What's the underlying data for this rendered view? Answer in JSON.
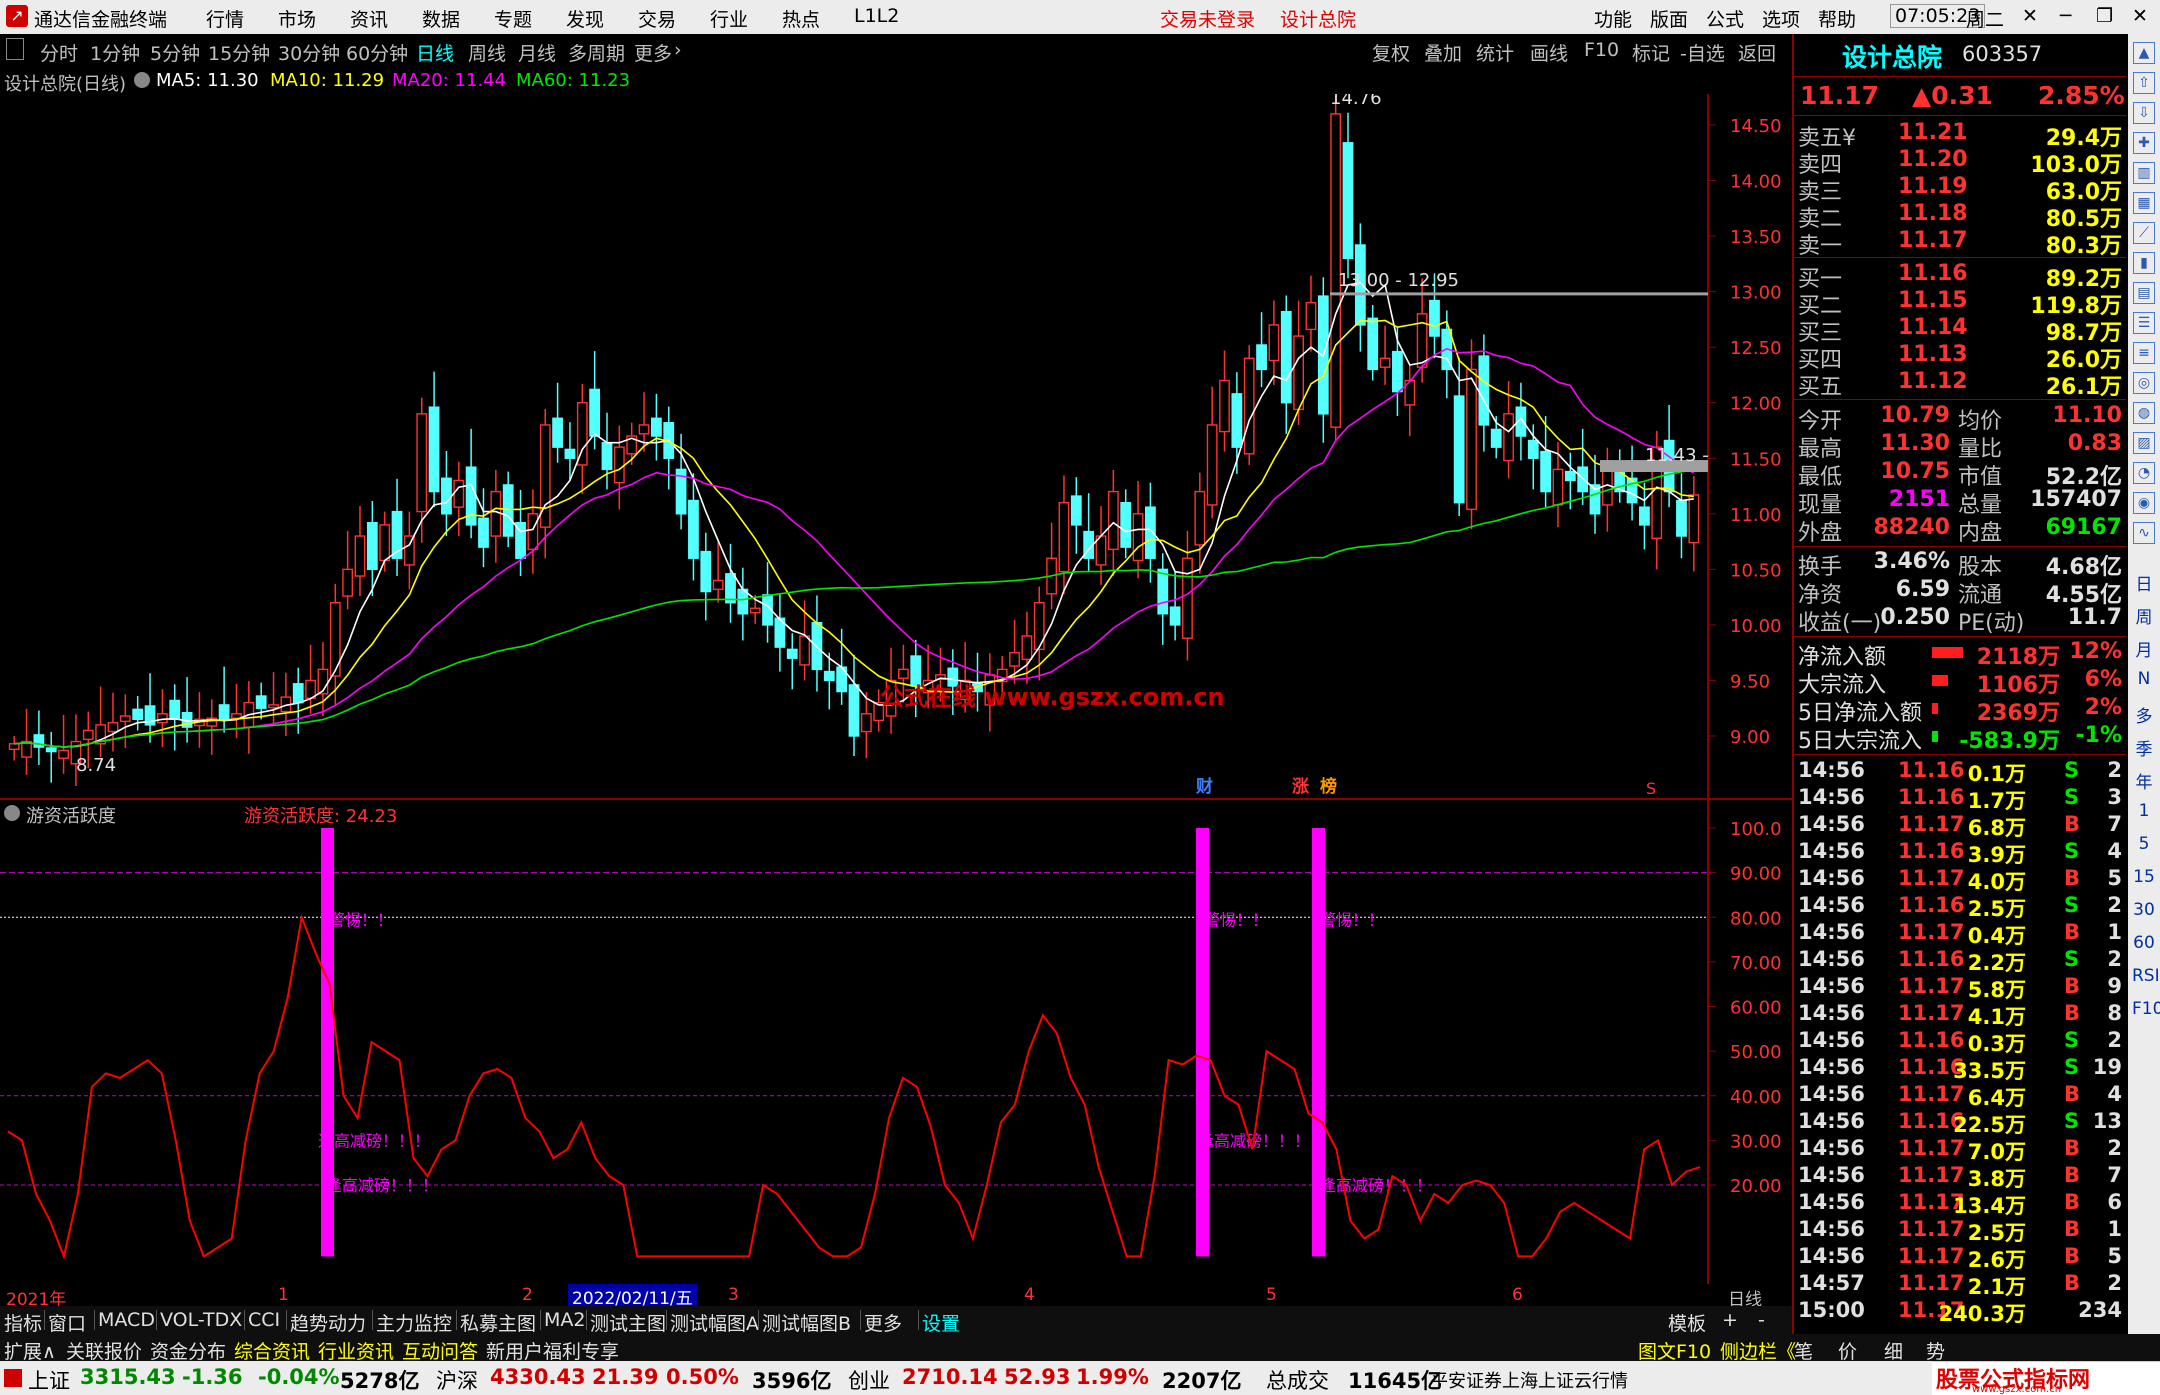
{
  "app": {
    "title": "通达信金融终端",
    "menus": [
      "行情",
      "市场",
      "资讯",
      "数据",
      "专题",
      "发现",
      "交易",
      "行业",
      "热点",
      "L1L2"
    ],
    "trade_status": "交易未登录",
    "stock_title": "设计总院",
    "right_menus": [
      "功能",
      "版面",
      "公式",
      "选项",
      "帮助"
    ],
    "time": "07:05:23",
    "weekday": "周二"
  },
  "periods": [
    "分时",
    "1分钟",
    "5分钟",
    "15分钟",
    "30分钟",
    "60分钟",
    "日线",
    "周线",
    "月线",
    "多周期",
    "更多"
  ],
  "chart_tools": [
    "复权",
    "叠加",
    "统计",
    "画线",
    "F10",
    "标记",
    "-自选",
    "返回"
  ],
  "main_info": {
    "name": "设计总院(日线)",
    "ma5": "MA5: 11.30",
    "ma10": "MA10: 11.29",
    "ma20": "MA20: 11.44",
    "ma60": "MA60: 11.23"
  },
  "price_axis": [
    "14.50",
    "14.00",
    "13.50",
    "13.00",
    "12.50",
    "12.00",
    "11.50",
    "11.00",
    "10.50",
    "10.00",
    "9.50",
    "9.00"
  ],
  "annotations": {
    "high": "14.76",
    "low": "8.74",
    "level1": "13.00 - 12.95",
    "level2": "11.43 -",
    "watermark": "公式在线  www.gszx.com.cn",
    "badges": [
      "财",
      "涨",
      "榜"
    ]
  },
  "sub_info": {
    "name": "游资活跃度",
    "value": "游资活跃度: 24.23"
  },
  "sub_axis": [
    "100.0",
    "90.00",
    "80.00",
    "70.00",
    "60.00",
    "50.00",
    "40.00",
    "30.00",
    "20.00"
  ],
  "sub_labels": {
    "warn": "警惕！！",
    "reduce": "逢高减磅！！！"
  },
  "date_axis": {
    "year": "2021年",
    "months": [
      "1",
      "2",
      "3",
      "4",
      "5",
      "6"
    ],
    "cursor_date": "2022/02/11/五",
    "period": "日线"
  },
  "bottom_tabs": [
    "指标",
    "窗口",
    "MACD",
    "VOL-TDX",
    "CCI",
    "趋势动力",
    "主力监控",
    "私募主图",
    "MA2",
    "测试主图",
    "测试幅图A",
    "测试幅图B",
    "更多",
    "设置"
  ],
  "bottom_right": [
    "模板",
    "+",
    "-"
  ],
  "bottom_row2": [
    "扩展∧",
    "关联报价",
    "资金分布",
    "综合资讯",
    "行业资讯",
    "互动问答",
    "新用户福利专享"
  ],
  "bottom_row2_right": [
    "图文F10",
    "侧边栏《",
    "笔",
    "价",
    "细",
    "势"
  ],
  "status": {
    "sh_name": "上证",
    "sh_val": "3315.43",
    "sh_chg": "-1.36",
    "sh_pct": "-0.04%",
    "sh_amt": "5278亿",
    "hs_name": "沪深",
    "hs_val": "4330.43",
    "hs_chg": "21.39",
    "hs_pct": "0.50%",
    "hs_amt": "3596亿",
    "cy_name": "创业",
    "cy_val": "2710.14",
    "cy_chg": "52.93",
    "cy_pct": "1.99%",
    "cy_amt": "2207亿",
    "total_label": "总成交",
    "total_val": "11645亿",
    "broker": "平安证券上海上证云行情",
    "brand": "股票公式指标网",
    "brand_url": "www.gszx.com.cn"
  },
  "quote": {
    "name": "设计总院",
    "code": "603357",
    "price": "11.17",
    "change": "▲0.31",
    "pct": "2.85%",
    "asks": [
      {
        "label": "卖五¥",
        "price": "11.21",
        "vol": "29.4万"
      },
      {
        "label": "卖四",
        "price": "11.20",
        "vol": "103.0万"
      },
      {
        "label": "卖三",
        "price": "11.19",
        "vol": "63.0万"
      },
      {
        "label": "卖二",
        "price": "11.18",
        "vol": "80.5万"
      },
      {
        "label": "卖一",
        "price": "11.17",
        "vol": "80.3万"
      }
    ],
    "bids": [
      {
        "label": "买一",
        "price": "11.16",
        "vol": "89.2万"
      },
      {
        "label": "买二",
        "price": "11.15",
        "vol": "119.8万"
      },
      {
        "label": "买三",
        "price": "11.14",
        "vol": "98.7万"
      },
      {
        "label": "买四",
        "price": "11.13",
        "vol": "26.0万"
      },
      {
        "label": "买五",
        "price": "11.12",
        "vol": "26.1万"
      }
    ],
    "stats": [
      {
        "l1": "今开",
        "v1": "10.79",
        "l2": "均价",
        "v2": "11.10"
      },
      {
        "l1": "最高",
        "v1": "11.30",
        "l2": "量比",
        "v2": "0.83"
      },
      {
        "l1": "最低",
        "v1": "10.75",
        "l2": "市值",
        "v2": "52.2亿"
      },
      {
        "l1": "现量",
        "v1": "2151",
        "l2": "总量",
        "v2": "157407"
      },
      {
        "l1": "外盘",
        "v1": "88240",
        "l2": "内盘",
        "v2": "69167"
      }
    ],
    "stats2": [
      {
        "l1": "换手",
        "v1": "3.46%",
        "l2": "股本",
        "v2": "4.68亿"
      },
      {
        "l1": "净资",
        "v1": "6.59",
        "l2": "流通",
        "v2": "4.55亿"
      },
      {
        "l1": "收益(一)",
        "v1": "0.250",
        "l2": "PE(动)",
        "v2": "11.7"
      }
    ],
    "flows": [
      {
        "label": "净流入额",
        "val": "2118万",
        "pct": "12%",
        "bar": 0.12
      },
      {
        "label": "大宗流入",
        "val": "1106万",
        "pct": "6%",
        "bar": 0.06
      },
      {
        "label": "5日净流入额",
        "val": "2369万",
        "pct": "2%",
        "bar": 0.02
      },
      {
        "label": "5日大宗流入",
        "val": "-583.9万",
        "pct": "-1%",
        "bar": 0.01
      }
    ],
    "ticks": [
      {
        "t": "14:56",
        "p": "11.16",
        "v": "0.1万",
        "s": "S",
        "n": "2"
      },
      {
        "t": "14:56",
        "p": "11.16",
        "v": "1.7万",
        "s": "S",
        "n": "3"
      },
      {
        "t": "14:56",
        "p": "11.17",
        "v": "6.8万",
        "s": "B",
        "n": "7"
      },
      {
        "t": "14:56",
        "p": "11.16",
        "v": "3.9万",
        "s": "S",
        "n": "4"
      },
      {
        "t": "14:56",
        "p": "11.17",
        "v": "4.0万",
        "s": "B",
        "n": "5"
      },
      {
        "t": "14:56",
        "p": "11.16",
        "v": "2.5万",
        "s": "S",
        "n": "2"
      },
      {
        "t": "14:56",
        "p": "11.17",
        "v": "0.4万",
        "s": "B",
        "n": "1"
      },
      {
        "t": "14:56",
        "p": "11.16",
        "v": "2.2万",
        "s": "S",
        "n": "2"
      },
      {
        "t": "14:56",
        "p": "11.17",
        "v": "5.8万",
        "s": "B",
        "n": "9"
      },
      {
        "t": "14:56",
        "p": "11.17",
        "v": "4.1万",
        "s": "B",
        "n": "8"
      },
      {
        "t": "14:56",
        "p": "11.16",
        "v": "0.3万",
        "s": "S",
        "n": "2"
      },
      {
        "t": "14:56",
        "p": "11.16",
        "v": "33.5万",
        "s": "S",
        "n": "19"
      },
      {
        "t": "14:56",
        "p": "11.17",
        "v": "6.4万",
        "s": "B",
        "n": "4"
      },
      {
        "t": "14:56",
        "p": "11.16",
        "v": "22.5万",
        "s": "S",
        "n": "13"
      },
      {
        "t": "14:56",
        "p": "11.17",
        "v": "7.0万",
        "s": "B",
        "n": "2"
      },
      {
        "t": "14:56",
        "p": "11.17",
        "v": "3.8万",
        "s": "B",
        "n": "7"
      },
      {
        "t": "14:56",
        "p": "11.17",
        "v": "13.4万",
        "s": "B",
        "n": "6"
      },
      {
        "t": "14:56",
        "p": "11.17",
        "v": "2.5万",
        "s": "B",
        "n": "1"
      },
      {
        "t": "14:56",
        "p": "11.17",
        "v": "2.6万",
        "s": "B",
        "n": "5"
      },
      {
        "t": "14:57",
        "p": "11.17",
        "v": "2.1万",
        "s": "B",
        "n": "2"
      },
      {
        "t": "15:00",
        "p": "11.17",
        "v": "240.3万",
        "s": "",
        "n": "234"
      }
    ]
  },
  "side_tools": [
    "日",
    "周",
    "月",
    "N",
    "多",
    "季",
    "年",
    "1",
    "5",
    "15",
    "30",
    "60",
    "RSI",
    "F10"
  ],
  "colors": {
    "up": "#ff3232",
    "down": "#54ffff",
    "ma5": "#ffffff",
    "ma10": "#ffff00",
    "ma20": "#ff00ff",
    "ma60": "#00e600",
    "indicator": "#ff0000",
    "signal": "#ff00ff"
  }
}
